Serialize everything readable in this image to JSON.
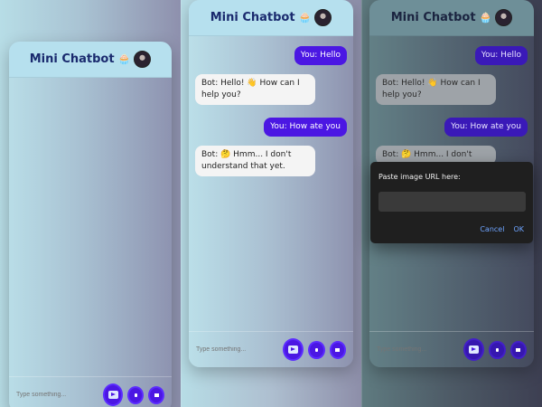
{
  "colors": {
    "user_bubble": "#4b17e3",
    "bot_bubble": "#f4f4f4",
    "header": "#b6e0ee",
    "title": "#1a2a6e",
    "dialog_bg": "#1f1f1f",
    "dialog_link": "#6ea4ff"
  },
  "chat": {
    "title": "Mini Chatbot",
    "title_emoji": "🧁",
    "input_placeholder": "Type something...",
    "messages": [
      {
        "role": "user",
        "text": "You: Hello"
      },
      {
        "role": "bot",
        "text": "Bot: Hello! 👋 How can I help you?"
      },
      {
        "role": "user",
        "text": "You: How ate you"
      },
      {
        "role": "bot",
        "text": "Bot: 🤔 Hmm... I don't understand that yet."
      }
    ],
    "dialog_truncated_bot": "Bot: 🤔 Hmm... I don't",
    "buttons": {
      "send_icon": "send-icon",
      "mic_icon": "mic-icon",
      "image_icon": "image-icon"
    }
  },
  "dialog": {
    "prompt": "Paste image URL here:",
    "cancel": "Cancel",
    "ok": "OK"
  }
}
